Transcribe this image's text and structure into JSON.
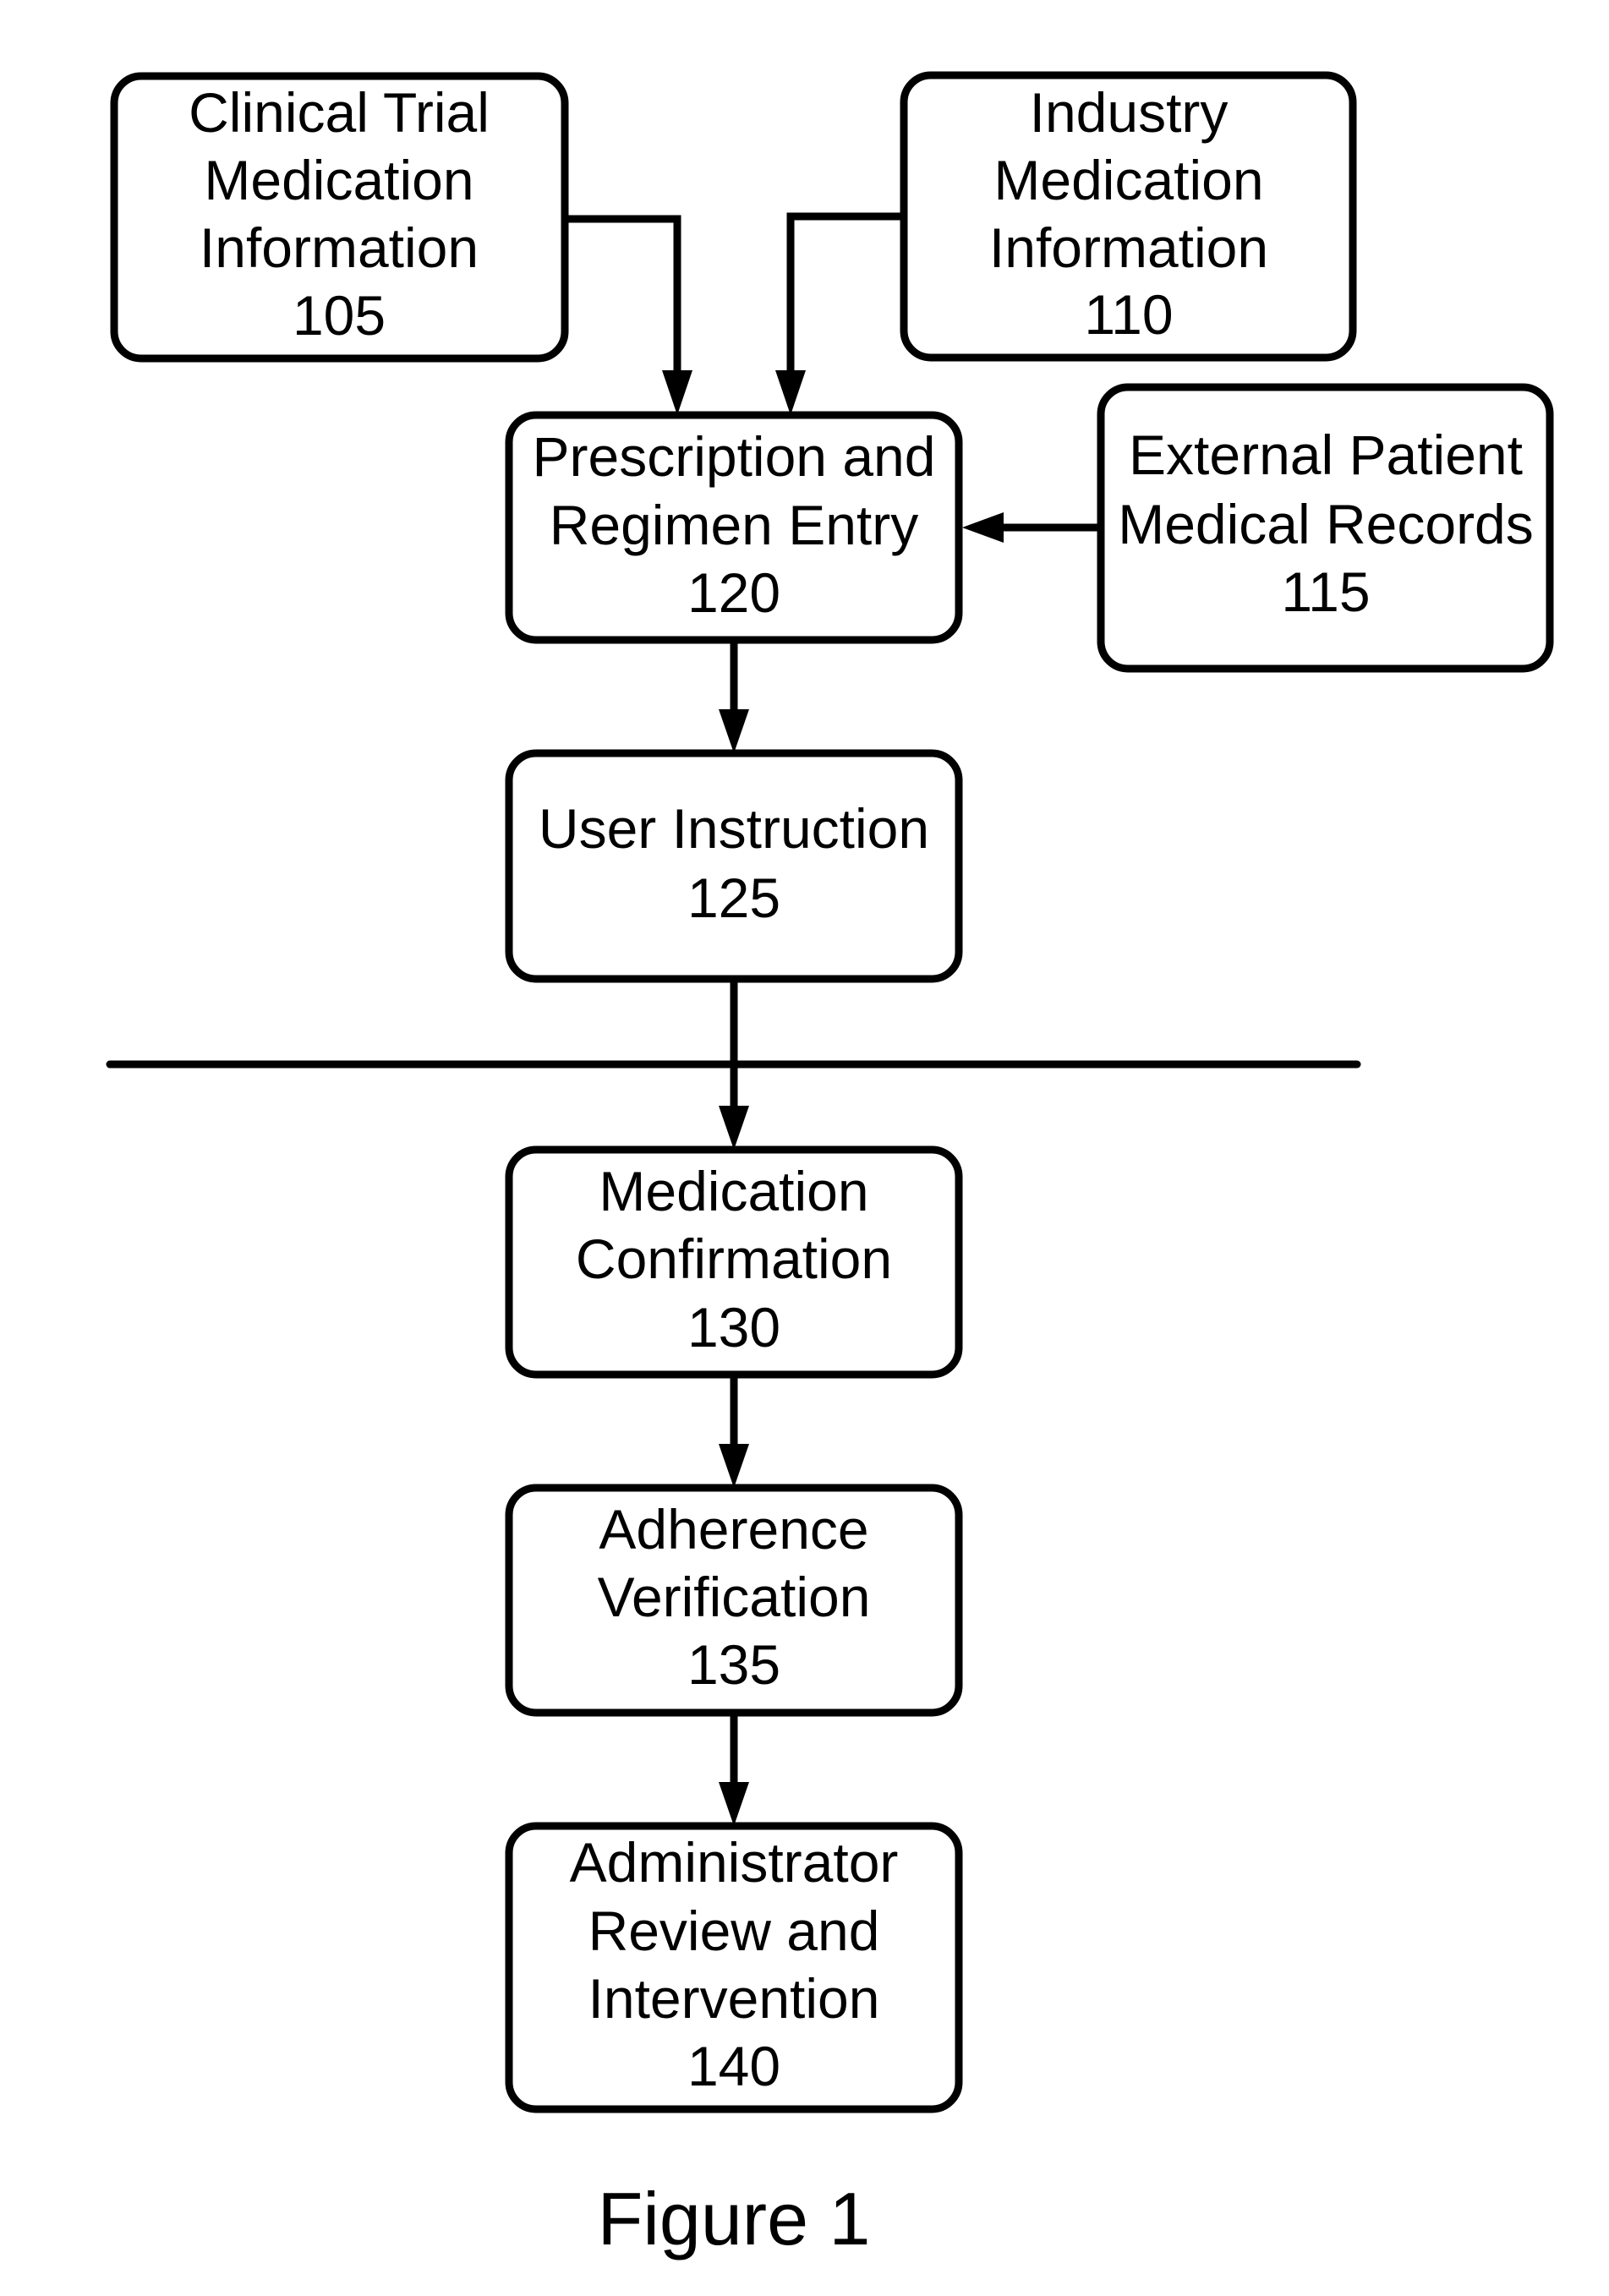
{
  "figure": {
    "caption": "Figure 1",
    "nodes": {
      "n105": {
        "id": "105",
        "lines": [
          "Clinical Trial",
          "Medication",
          "Information",
          "105"
        ]
      },
      "n110": {
        "id": "110",
        "lines": [
          "Industry",
          "Medication",
          "Information",
          "110"
        ]
      },
      "n115": {
        "id": "115",
        "lines": [
          "External Patient",
          "Medical Records",
          "115"
        ]
      },
      "n120": {
        "id": "120",
        "lines": [
          "Prescription and",
          "Regimen Entry",
          "120"
        ]
      },
      "n125": {
        "id": "125",
        "lines": [
          "User Instruction",
          "125"
        ]
      },
      "n130": {
        "id": "130",
        "lines": [
          "Medication",
          "Confirmation",
          "130"
        ]
      },
      "n135": {
        "id": "135",
        "lines": [
          "Adherence",
          "Verification",
          "135"
        ]
      },
      "n140": {
        "id": "140",
        "lines": [
          "Administrator",
          "Review and",
          "Intervention",
          "140"
        ]
      }
    },
    "edges": [
      {
        "from": "105",
        "to": "120"
      },
      {
        "from": "110",
        "to": "120"
      },
      {
        "from": "115",
        "to": "120"
      },
      {
        "from": "120",
        "to": "125"
      },
      {
        "from": "125",
        "to": "130"
      },
      {
        "from": "130",
        "to": "135"
      },
      {
        "from": "135",
        "to": "140"
      }
    ],
    "colors": {
      "stroke": "#000000",
      "background": "#ffffff"
    }
  }
}
